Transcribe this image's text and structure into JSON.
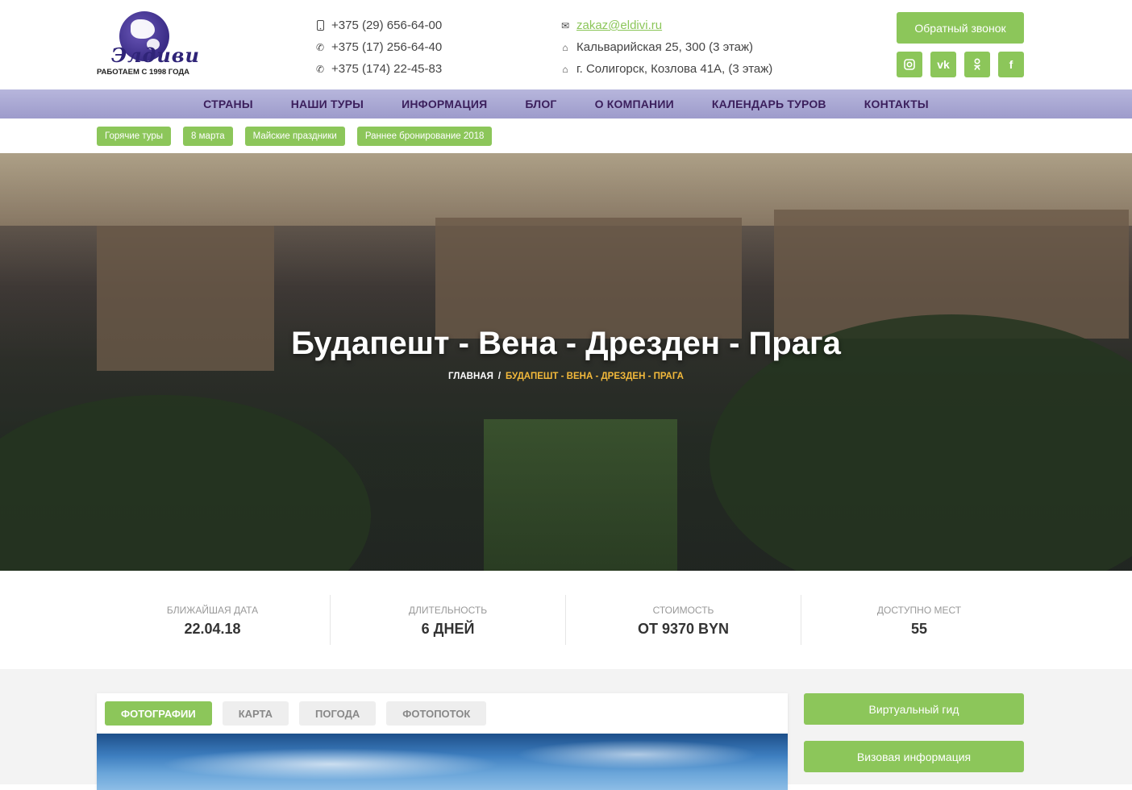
{
  "logo": {
    "script": "Элдиви",
    "tagline": "РАБОТАЕМ С 1998 ГОДА"
  },
  "contacts": {
    "phones": [
      "+375 (29) 656-64-00",
      "+375 (17) 256-64-40",
      "+375 (174) 22-45-83"
    ],
    "email": "zakaz@eldivi.ru",
    "addresses": [
      "Кальварийская 25, 300 (3 этаж)",
      "г. Солигорск, Козлова 41А, (3 этаж)"
    ]
  },
  "callback_label": "Обратный звонок",
  "socials": [
    "instagram-icon",
    "vk-icon",
    "odnoklassniki-icon",
    "facebook-icon"
  ],
  "nav": [
    "СТРАНЫ",
    "НАШИ ТУРЫ",
    "ИНФОРМАЦИЯ",
    "БЛОГ",
    "О КОМПАНИИ",
    "КАЛЕНДАРЬ ТУРОВ",
    "КОНТАКТЫ"
  ],
  "tags": [
    "Горячие туры",
    "8 марта",
    "Майские праздники",
    "Раннее бронирование 2018"
  ],
  "hero": {
    "title": "Будапешт - Вена - Дрезден - Прага",
    "breadcrumb_home": "ГЛАВНАЯ",
    "breadcrumb_sep": "/",
    "breadcrumb_current": "БУДАПЕШТ - ВЕНА - ДРЕЗДЕН - ПРАГА"
  },
  "stats": [
    {
      "label": "БЛИЖАЙШАЯ ДАТА",
      "value": "22.04.18"
    },
    {
      "label": "ДЛИТЕЛЬНОСТЬ",
      "value": "6 ДНЕЙ"
    },
    {
      "label": "СТОИМОСТЬ",
      "value": "ОТ 9370 BYN"
    },
    {
      "label": "ДОСТУПНО МЕСТ",
      "value": "55"
    }
  ],
  "media_tabs": [
    "ФОТОГРАФИИ",
    "КАРТА",
    "ПОГОДА",
    "ФОТОПОТОК"
  ],
  "side_buttons": [
    "Виртуальный гид",
    "Визовая информация"
  ],
  "colors": {
    "accent": "#8cc65a",
    "nav_bg": "#a9a8d4",
    "nav_text": "#3b1f5c",
    "breadcrumb_current": "#f3b93b"
  }
}
